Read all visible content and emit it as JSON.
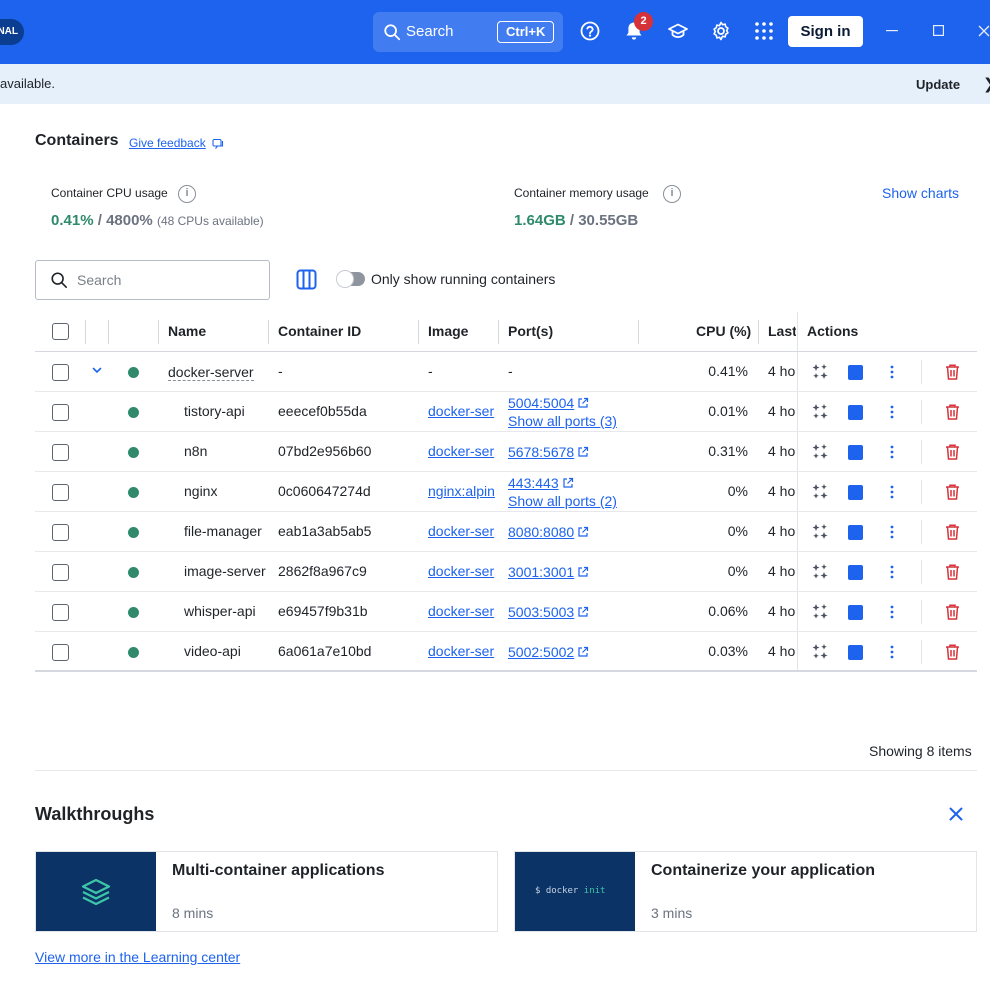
{
  "titlebar": {
    "plan_label": "NAL",
    "search_label": "Search",
    "search_shortcut": "Ctrl+K",
    "notification_count": "2",
    "signin_label": "Sign in",
    "accent_color": "#1d63ed"
  },
  "banner": {
    "text": "available.",
    "update_label": "Update",
    "close_glyph": "❯"
  },
  "header": {
    "title": "Containers",
    "feedback_label": "Give feedback"
  },
  "stats": {
    "cpu_label": "Container CPU usage",
    "cpu_used": "0.41%",
    "cpu_sep": " / ",
    "cpu_total": "4800%",
    "cpu_note": "(48 CPUs available)",
    "mem_label": "Container memory usage",
    "mem_used": "1.64GB",
    "mem_sep": " / ",
    "mem_total": "30.55GB",
    "show_charts_label": "Show charts",
    "info_glyph": "i"
  },
  "toolbar": {
    "search_placeholder": "Search",
    "toggle_label": "Only show running containers"
  },
  "table": {
    "headers": {
      "name": "Name",
      "container_id": "Container ID",
      "image": "Image",
      "ports": "Port(s)",
      "cpu": "CPU (%)",
      "last": "Last",
      "actions": "Actions"
    },
    "parent": {
      "name": "docker-server",
      "container_id": "-",
      "image": "-",
      "ports": "-",
      "cpu": "0.41%",
      "last": "4 ho"
    },
    "rows": [
      {
        "name": "tistory-api",
        "container_id": "eeecef0b55da",
        "image": "docker-ser",
        "port": "5004:5004",
        "ports_more": "Show all ports (3)",
        "cpu": "0.01%",
        "last": "4 ho"
      },
      {
        "name": "n8n",
        "container_id": "07bd2e956b60",
        "image": "docker-ser",
        "port": "5678:5678",
        "ports_more": "",
        "cpu": "0.31%",
        "last": "4 ho"
      },
      {
        "name": "nginx",
        "container_id": "0c060647274d",
        "image": "nginx:alpin",
        "port": "443:443",
        "ports_more": "Show all ports (2)",
        "cpu": "0%",
        "last": "4 ho"
      },
      {
        "name": "file-manager",
        "container_id": "eab1a3ab5ab5",
        "image": "docker-ser",
        "port": "8080:8080",
        "ports_more": "",
        "cpu": "0%",
        "last": "4 ho"
      },
      {
        "name": "image-server",
        "container_id": "2862f8a967c9",
        "image": "docker-ser",
        "port": "3001:3001",
        "ports_more": "",
        "cpu": "0%",
        "last": "4 ho"
      },
      {
        "name": "whisper-api",
        "container_id": "e69457f9b31b",
        "image": "docker-ser",
        "port": "5003:5003",
        "ports_more": "",
        "cpu": "0.06%",
        "last": "4 ho"
      },
      {
        "name": "video-api",
        "container_id": "6a061a7e10bd",
        "image": "docker-ser",
        "port": "5002:5002",
        "ports_more": "",
        "cpu": "0.03%",
        "last": "4 ho"
      }
    ],
    "status_color": "#2f8a6b",
    "showing_label": "Showing 8 items"
  },
  "walkthroughs": {
    "title": "Walkthroughs",
    "cards": [
      {
        "title": "Multi-container applications",
        "duration": "8 mins"
      },
      {
        "title": "Containerize your application",
        "duration": "3 mins",
        "command_prompt": "$ docker",
        "command_keyword": "init"
      }
    ],
    "learn_link": "View more in the Learning center"
  }
}
